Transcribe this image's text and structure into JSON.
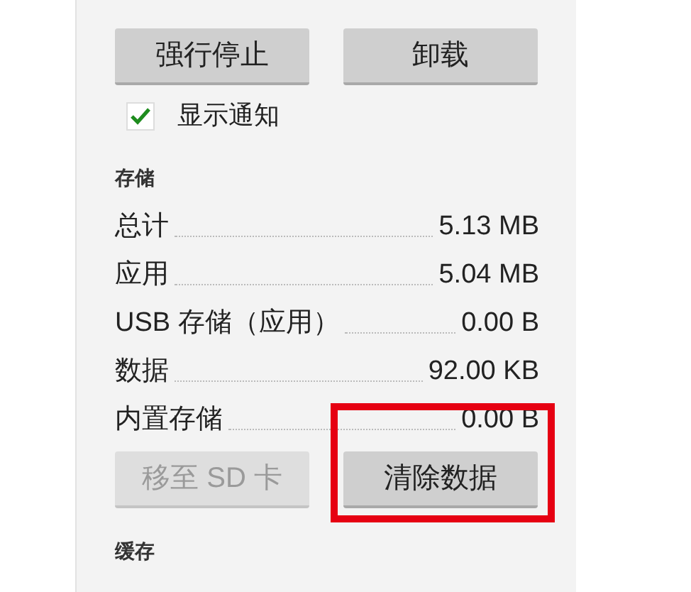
{
  "top_buttons": [
    {
      "label": "强行停止",
      "disabled": false
    },
    {
      "label": "卸载",
      "disabled": false
    }
  ],
  "notification": {
    "label": "显示通知",
    "checked": true
  },
  "storage": {
    "title": "存储",
    "rows": [
      {
        "label": "总计",
        "value": "5.13 MB"
      },
      {
        "label": "应用",
        "value": "5.04 MB"
      },
      {
        "label": "USB 存储（应用）",
        "value": "0.00 B"
      },
      {
        "label": "数据",
        "value": "92.00 KB"
      },
      {
        "label": "内置存储",
        "value": "0.00 B"
      }
    ],
    "buttons": [
      {
        "label": "移至 SD 卡",
        "disabled": true,
        "highlighted": false
      },
      {
        "label": "清除数据",
        "disabled": false,
        "highlighted": true
      }
    ]
  },
  "cache": {
    "title": "缓存"
  }
}
